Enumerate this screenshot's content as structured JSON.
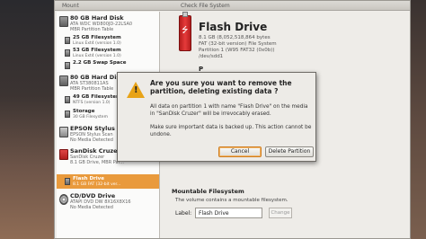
{
  "window": {
    "mount_label": "Mount",
    "title": "Check File System"
  },
  "sidebar": {
    "devices": [
      {
        "name": "80 GB Hard Disk",
        "detail1": "ATA WDC WD800JD-22LSA0",
        "detail2": "MBR Partition Table"
      },
      {
        "name": "80 GB Hard Disk",
        "detail1": "ATA ST380811AS",
        "detail2": "MBR Partition Table"
      },
      {
        "name": "EPSON Stylus Sto",
        "detail1": "EPSON Stylus Scan",
        "detail2": "No Media Detected"
      },
      {
        "name": "SanDisk Cruzer",
        "detail1": "SanDisk Cruzer",
        "detail2": "8.1 GB Drive, MBR Par..."
      },
      {
        "name": "CD/DVD Drive",
        "detail1": "ATAPI DVD DW 8X16X8X16",
        "detail2": "No Media Detected"
      }
    ],
    "partitions": [
      {
        "name": "25 GB Filesystem",
        "detail": "Linux Ext4 (version 1.0)"
      },
      {
        "name": "53 GB Filesystem",
        "detail": "Linux Ext4 (version 1.0)"
      },
      {
        "name": "2.2 GB Swap Space",
        "detail": ""
      },
      {
        "name": "49 GB Filesystem",
        "detail": "NTFS (version 1.0)"
      },
      {
        "name": "Storage",
        "detail": "30 GB Filesystem"
      },
      {
        "name": "Flash Drive",
        "detail": "8.1 GB FAT (32-bit ver..."
      }
    ]
  },
  "main": {
    "title": "Flash Drive",
    "lines": [
      "8.1 GB (8,052,518,864 bytes",
      "FAT (32-bit version) File System",
      "Partition 1 (W95 FAT32 (0x0b))",
      "/dev/sdd1"
    ],
    "section_letter": "P",
    "mountable_title": "Mountable Filesystem",
    "mountable_desc": "The volume contains a mountable filesystem.",
    "label_caption": "Label:",
    "label_value": "Flash Drive",
    "change_button": "Change"
  },
  "dialog": {
    "heading": "Are you sure you want to remove the partition, deleting existing data ?",
    "body1": "All data on partition 1 with name \"Flash Drive\" on the media in \"SanDisk Cruzer\" will be irrevocably erased.",
    "body2": "Make sure important data is backed up. This action cannot be undone.",
    "cancel": "Cancel",
    "delete": "Delete Partition"
  },
  "colors": {
    "selection": "#e99a3c",
    "warning": "#e8a317",
    "usb": "#d12b2b"
  },
  "icons": [
    "harddisk-icon",
    "partition-icon",
    "printer-icon",
    "usb-drive-icon",
    "optical-drive-icon",
    "warning-icon"
  ]
}
